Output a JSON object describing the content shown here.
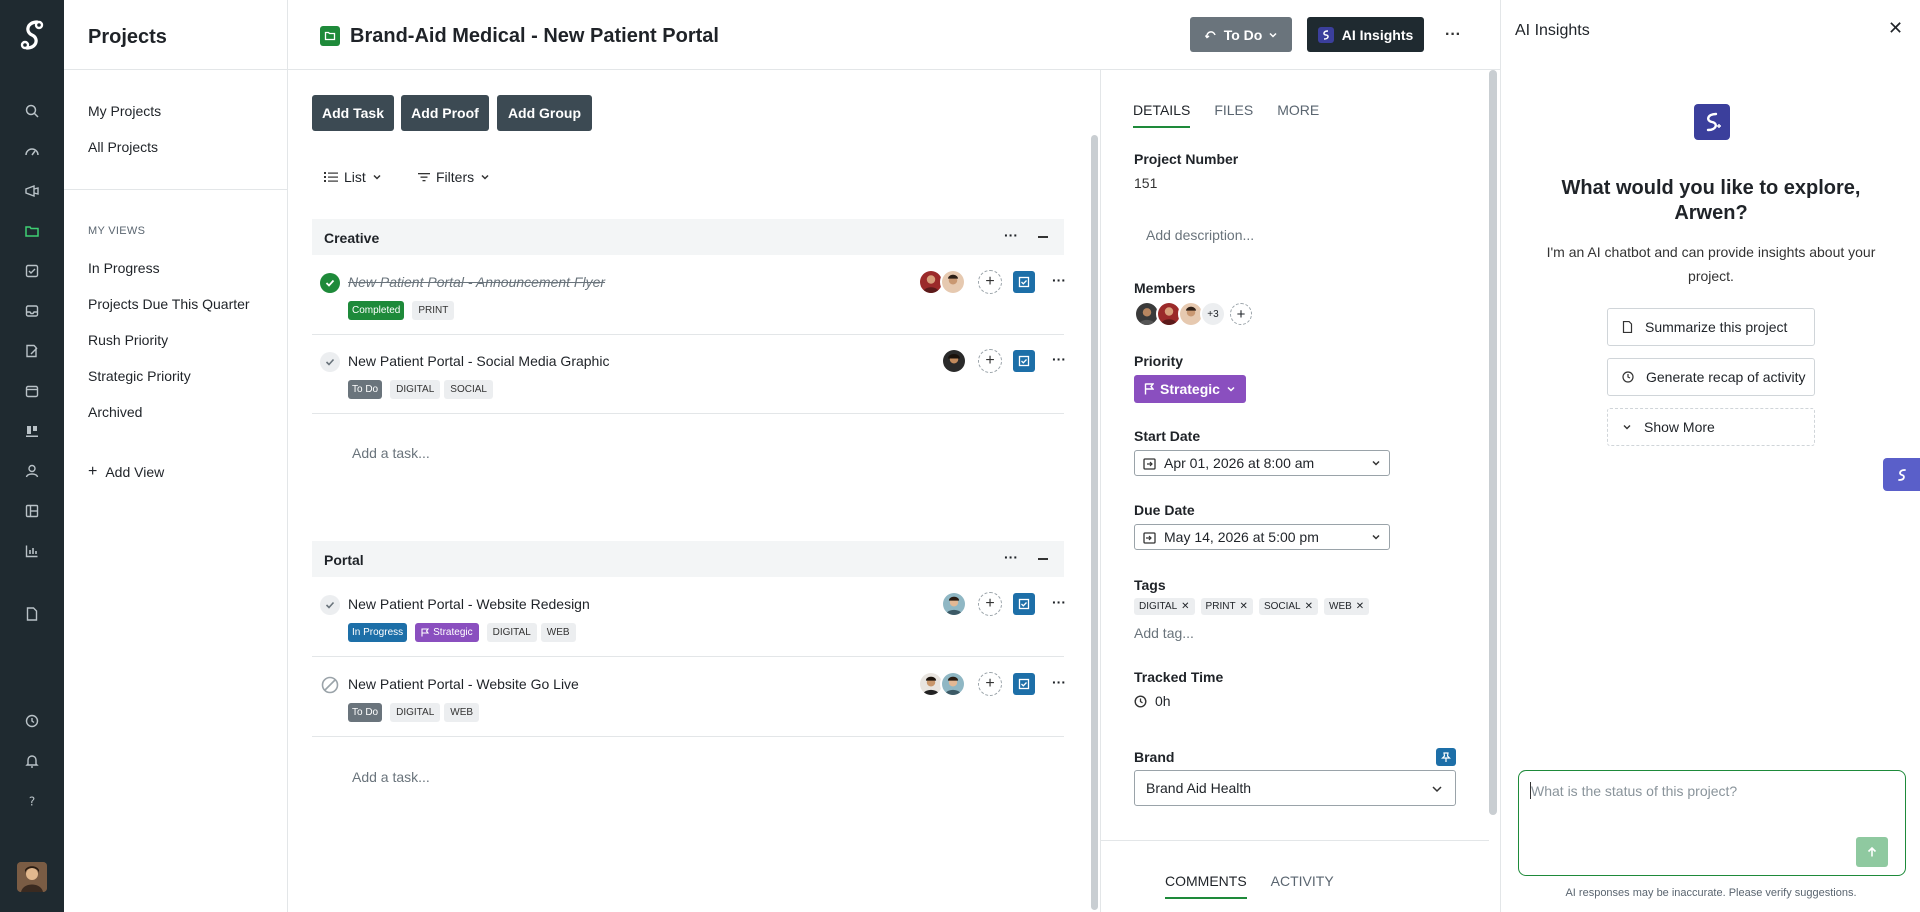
{
  "sidebar": {
    "title": "Projects",
    "links": [
      "My Projects",
      "All Projects"
    ],
    "section_label": "MY VIEWS",
    "views": [
      "In Progress",
      "Projects Due This Quarter",
      "Rush Priority",
      "Strategic Priority",
      "Archived"
    ],
    "add_view": "Add View"
  },
  "header": {
    "title": "Brand-Aid Medical - New Patient Portal",
    "status_label": "To Do",
    "ai_label": "AI Insights",
    "more": "···"
  },
  "toolbar": {
    "add_task": "Add Task",
    "add_proof": "Add Proof",
    "add_group": "Add Group",
    "view_label": "List",
    "filters_label": "Filters"
  },
  "groups": [
    {
      "name": "Creative",
      "add_task": "Add a task...",
      "tasks": [
        {
          "name": "New Patient Portal - Announcement Flyer",
          "status": "Completed",
          "tags": [
            "PRINT"
          ]
        },
        {
          "name": "New Patient Portal - Social Media Graphic",
          "status": "To Do",
          "tags": [
            "DIGITAL",
            "SOCIAL"
          ]
        }
      ]
    },
    {
      "name": "Portal",
      "add_task": "Add a task...",
      "tasks": [
        {
          "name": "New Patient Portal - Website Redesign",
          "status": "In Progress",
          "priority": "Strategic",
          "tags": [
            "DIGITAL",
            "WEB"
          ]
        },
        {
          "name": "New Patient Portal - Website Go Live",
          "status": "To Do",
          "tags": [
            "DIGITAL",
            "WEB"
          ]
        }
      ]
    }
  ],
  "group_more": "···",
  "row_more": "···",
  "details": {
    "tabs": [
      "DETAILS",
      "FILES",
      "MORE"
    ],
    "project_number_label": "Project Number",
    "project_number": "151",
    "description_placeholder": "Add description...",
    "members_label": "Members",
    "members_more": "+3",
    "priority_label": "Priority",
    "priority": "Strategic",
    "start_label": "Start Date",
    "start_value": "Apr 01, 2026 at 8:00 am",
    "due_label": "Due Date",
    "due_value": "May 14, 2026 at 5:00 pm",
    "tags_label": "Tags",
    "tags": [
      "DIGITAL",
      "PRINT",
      "SOCIAL",
      "WEB"
    ],
    "add_tag": "Add tag...",
    "tracked_label": "Tracked Time",
    "tracked_value": "0h",
    "brand_label": "Brand",
    "brand_value": "Brand Aid Health",
    "bottom_tabs": [
      "COMMENTS",
      "ACTIVITY"
    ]
  },
  "ai": {
    "title": "AI Insights",
    "question": "What would you like to explore, Arwen?",
    "description": "I'm an AI chatbot and can provide insights about your project.",
    "actions": [
      "Summarize this project",
      "Generate recap of activity",
      "Show More"
    ],
    "input_placeholder": "What is the status of this project?",
    "footer": "AI responses may be inaccurate. Please verify suggestions."
  },
  "colors": {
    "rail": "#1f2a30",
    "accent_green": "#1e8a3a",
    "completed": "#1e8a3a",
    "todo": "#6a747c",
    "in_progress": "#1d6fa8",
    "strategic": "#8a4fbf",
    "ai_brand": "#3b3f9c"
  }
}
